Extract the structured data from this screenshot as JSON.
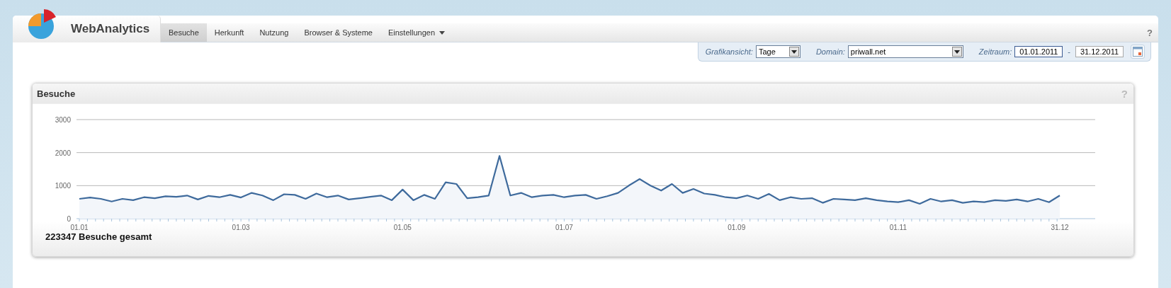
{
  "app": {
    "name": "WebAnalytics",
    "help": "?"
  },
  "tabs": [
    {
      "label": "Besuche",
      "selected": true,
      "menu": false
    },
    {
      "label": "Herkunft",
      "selected": false,
      "menu": false
    },
    {
      "label": "Nutzung",
      "selected": false,
      "menu": false
    },
    {
      "label": "Browser & Systeme",
      "selected": false,
      "menu": false
    },
    {
      "label": "Einstellungen",
      "selected": false,
      "menu": true
    }
  ],
  "filters": {
    "view_label": "Grafikansicht:",
    "view_value": "Tage",
    "domain_label": "Domain:",
    "domain_value": "priwall.net",
    "range_label": "Zeitraum:",
    "from": "01.01.2011",
    "separator": "-",
    "to": "31.12.2011"
  },
  "panel": {
    "title": "Besuche",
    "help": "?",
    "total": "223347 Besuche gesamt",
    "chart_data": {
      "type": "area",
      "categories": [
        "01.01",
        null,
        null,
        null,
        null,
        null,
        null,
        null,
        null,
        null,
        null,
        null,
        null,
        null,
        null,
        "01.03",
        null,
        null,
        null,
        null,
        null,
        null,
        null,
        null,
        null,
        null,
        null,
        null,
        null,
        null,
        "01.05",
        null,
        null,
        null,
        null,
        null,
        null,
        null,
        null,
        null,
        null,
        null,
        null,
        null,
        null,
        "01.07",
        null,
        null,
        null,
        null,
        null,
        null,
        null,
        null,
        null,
        null,
        null,
        null,
        null,
        null,
        null,
        "01.09",
        null,
        null,
        null,
        null,
        null,
        null,
        null,
        null,
        null,
        null,
        null,
        null,
        null,
        null,
        "01.11",
        null,
        null,
        null,
        null,
        null,
        null,
        null,
        null,
        null,
        null,
        null,
        null,
        null,
        null,
        "31.12"
      ],
      "series": [
        {
          "color": "#3e6a9c",
          "values": [
            600,
            640,
            600,
            520,
            600,
            560,
            650,
            620,
            680,
            660,
            700,
            580,
            690,
            650,
            720,
            640,
            780,
            700,
            560,
            740,
            720,
            600,
            760,
            650,
            700,
            580,
            620,
            660,
            700,
            560,
            880,
            560,
            720,
            600,
            1100,
            1050,
            620,
            650,
            700,
            1900,
            700,
            780,
            650,
            700,
            720,
            650,
            700,
            720,
            600,
            680,
            780,
            1000,
            1200,
            1000,
            850,
            1050,
            780,
            900,
            760,
            720,
            650,
            620,
            700,
            600,
            750,
            560,
            650,
            600,
            620,
            480,
            600,
            580,
            560,
            620,
            560,
            520,
            500,
            560,
            450,
            600,
            520,
            560,
            480,
            520,
            500,
            560,
            540,
            580,
            520,
            600,
            500,
            700
          ]
        }
      ],
      "ylim": [
        0,
        3000
      ],
      "yticks": [
        0,
        1000,
        2000,
        3000
      ]
    }
  }
}
